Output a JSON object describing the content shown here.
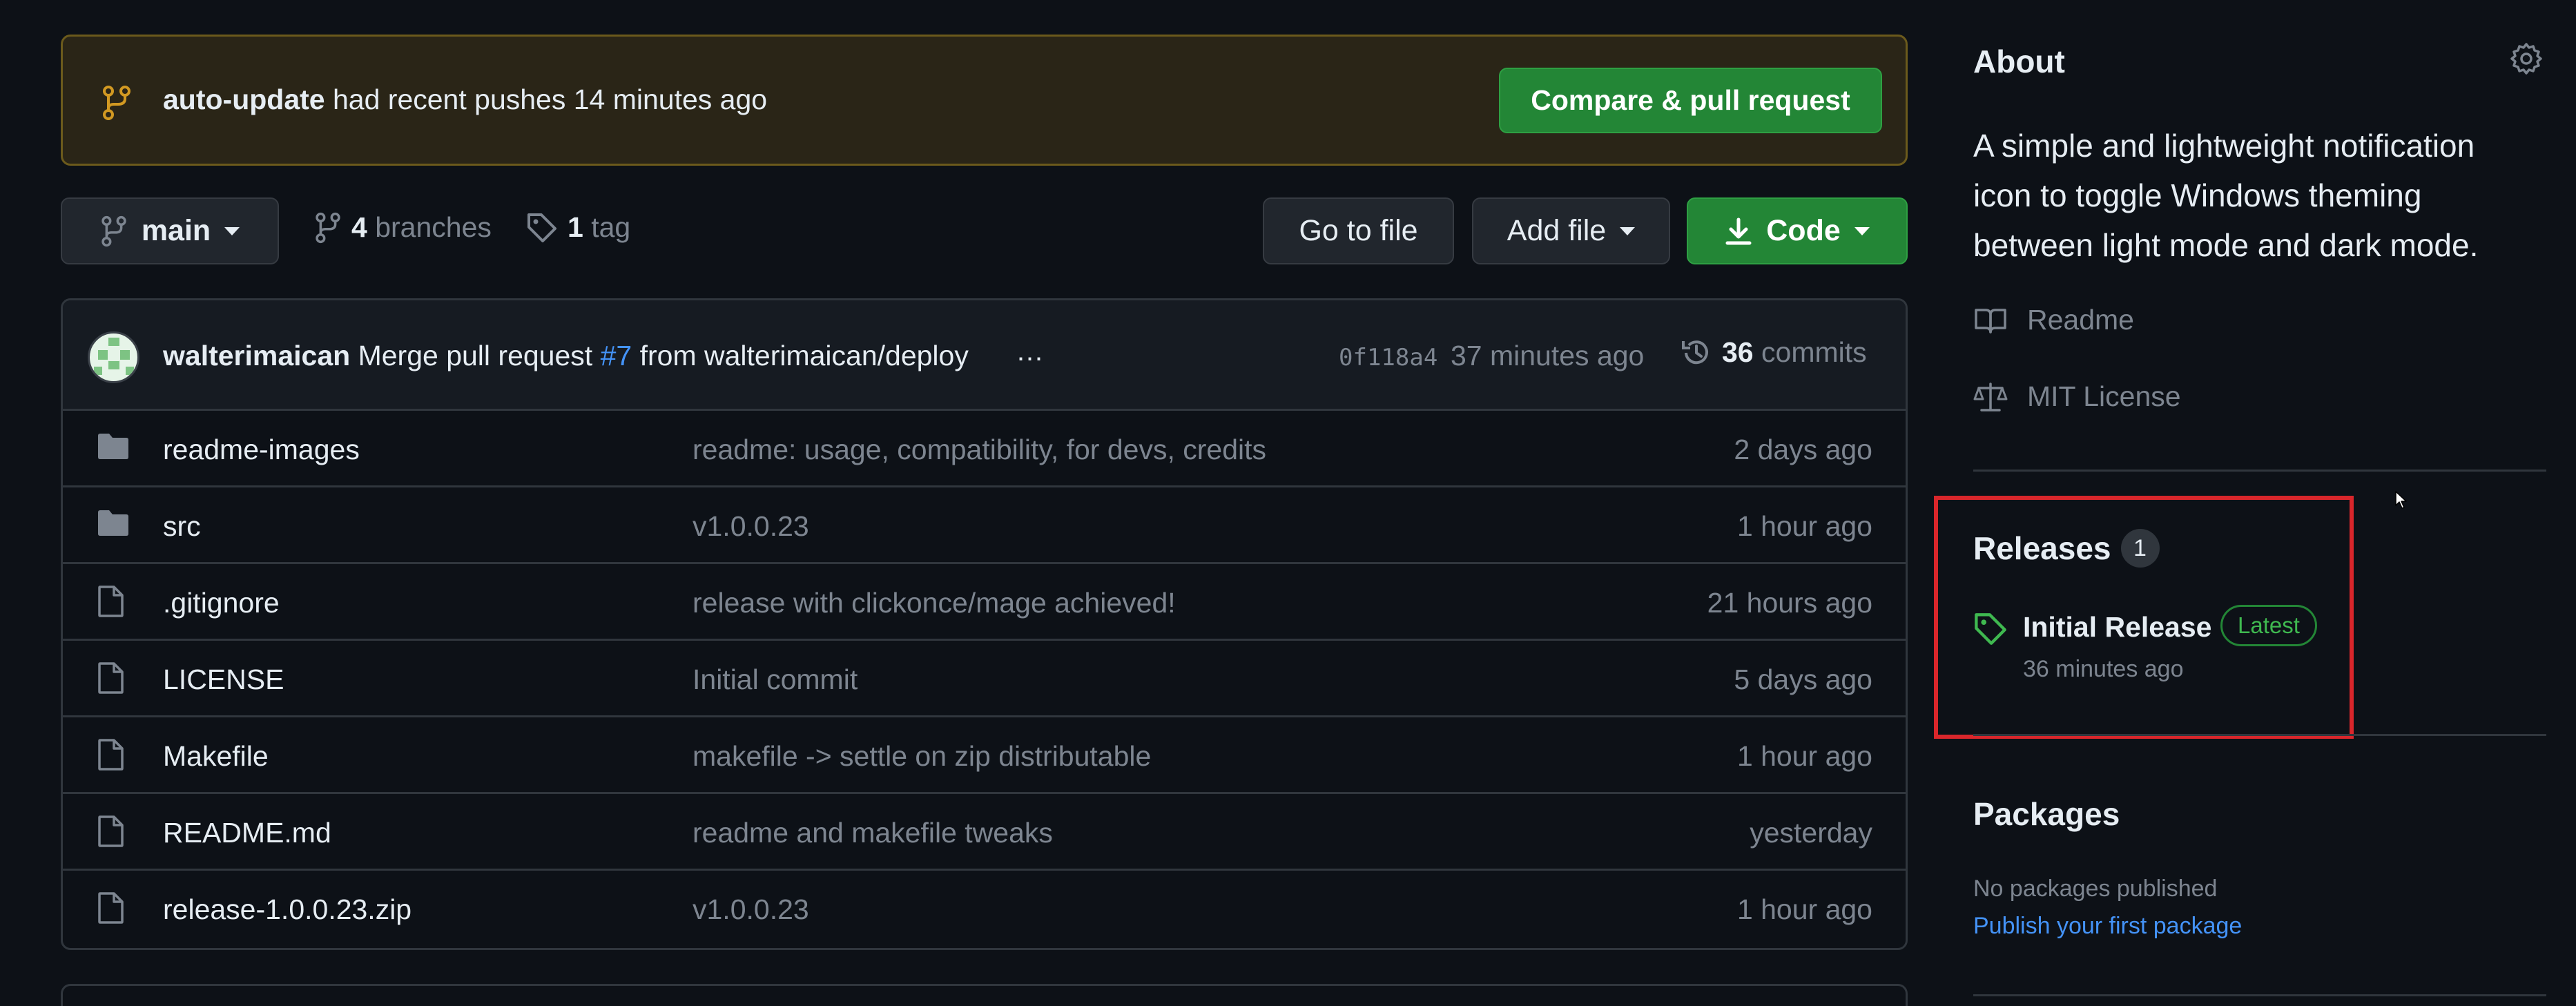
{
  "banner": {
    "branch_name": "auto-update",
    "text_suffix": "had recent pushes 14 minutes ago",
    "compare_button": "Compare & pull request"
  },
  "toolbar": {
    "branch": "main",
    "branches_count": "4",
    "branches_label": "branches",
    "tags_count": "1",
    "tags_label": "tag",
    "go_to_file": "Go to file",
    "add_file": "Add file",
    "code": "Code"
  },
  "latest_commit": {
    "author": "walterimaican",
    "message_prefix": "Merge pull request",
    "pr_number": "#7",
    "message_suffix": "from walterimaican/deploy",
    "ellipsis": "…",
    "sha": "0f118a4",
    "time": "37 minutes ago",
    "commits_count": "36",
    "commits_label": "commits"
  },
  "files": [
    {
      "type": "folder",
      "name": "readme-images",
      "message": "readme: usage, compatibility, for devs, credits",
      "time": "2 days ago"
    },
    {
      "type": "folder",
      "name": "src",
      "message": "v1.0.0.23",
      "time": "1 hour ago"
    },
    {
      "type": "file",
      "name": ".gitignore",
      "message": "release with clickonce/mage achieved!",
      "time": "21 hours ago"
    },
    {
      "type": "file",
      "name": "LICENSE",
      "message": "Initial commit",
      "time": "5 days ago"
    },
    {
      "type": "file",
      "name": "Makefile",
      "message": "makefile -> settle on zip distributable",
      "time": "1 hour ago"
    },
    {
      "type": "file",
      "name": "README.md",
      "message": "readme and makefile tweaks",
      "time": "yesterday"
    },
    {
      "type": "file",
      "name": "release-1.0.0.23.zip",
      "message": "v1.0.0.23",
      "time": "1 hour ago"
    }
  ],
  "about": {
    "title": "About",
    "description": "A simple and lightweight notification icon to toggle Windows theming between light mode and dark mode.",
    "readme_label": "Readme",
    "license_label": "MIT License"
  },
  "releases": {
    "title": "Releases",
    "count": "1",
    "name": "Initial Release",
    "badge": "Latest",
    "time": "36 minutes ago"
  },
  "packages": {
    "title": "Packages",
    "empty_text": "No packages published",
    "publish_link": "Publish your first package"
  },
  "colors": {
    "background": "#0d1117",
    "primary_button": "#238636",
    "link": "#4493f8",
    "muted_text": "#7d8590",
    "highlight": "#d9262b"
  }
}
